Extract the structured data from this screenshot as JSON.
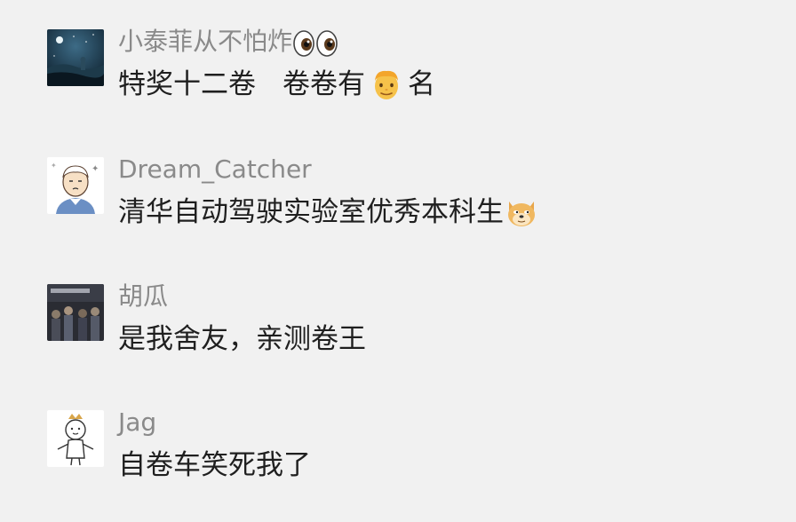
{
  "comments": [
    {
      "username": "小泰菲从不怕炸",
      "username_emoji": "eyes-emoji",
      "message_part1": "特奖十二卷",
      "message_part2": "卷卷有",
      "message_emoji": "man-face-emoji",
      "message_part3": "名"
    },
    {
      "username": "Dream_Catcher",
      "message": "清华自动驾驶实验室优秀本科生",
      "message_emoji": "doge-emoji"
    },
    {
      "username": "胡瓜",
      "message": "是我舍友，亲测卷王"
    },
    {
      "username": "Jag",
      "message": "自卷车笑死我了"
    }
  ]
}
